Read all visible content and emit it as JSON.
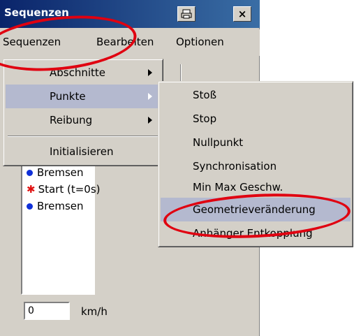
{
  "window": {
    "title": "Sequenzen",
    "buttons": {
      "print_icon": "printer-icon",
      "close": "×"
    }
  },
  "menubar": [
    "Sequenzen",
    "Bearbeiten",
    "Optionen"
  ],
  "dropdown": {
    "items": [
      {
        "label": "Abschnitte",
        "submenu": true
      },
      {
        "label": "Punkte",
        "submenu": true,
        "highlighted": true
      },
      {
        "label": "Reibung",
        "submenu": true
      },
      {
        "label": "Initialisieren",
        "submenu": false
      }
    ]
  },
  "submenu": {
    "items": [
      "Stoß",
      "Stop",
      "Nullpunkt",
      "Synchronisation",
      "Min Max Geschw.",
      "Geometrieveränderung",
      "Anhänger Entkopplung"
    ],
    "highlighted": "Geometrieveränderung"
  },
  "list": {
    "items": [
      {
        "marker": "dot",
        "label": "Bremsen"
      },
      {
        "marker": "star",
        "label": "Start (t=0s)"
      },
      {
        "marker": "dot",
        "label": "Bremsen"
      }
    ]
  },
  "speed": {
    "value": "0",
    "unit": "km/h"
  },
  "colors": {
    "highlight": "#b4b9cf",
    "annotation": "#e00010",
    "title_bar": "#0a246a"
  }
}
